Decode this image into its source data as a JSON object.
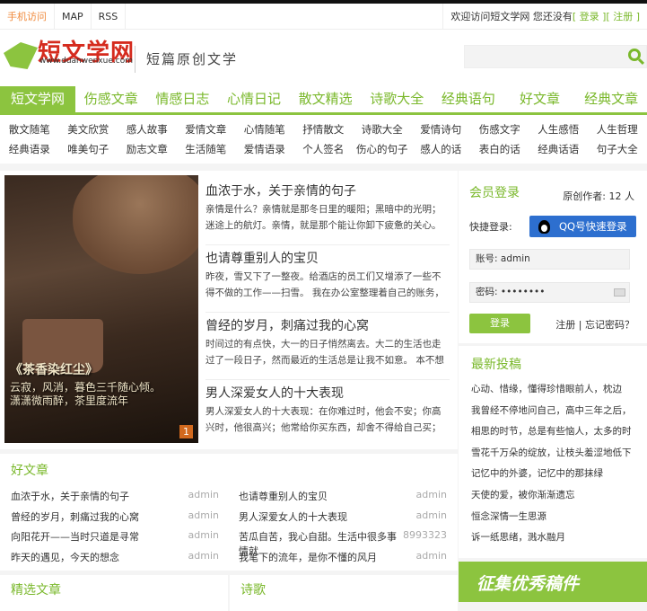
{
  "topbar": {
    "mobile": "手机访问",
    "map": "MAP",
    "rss": "RSS",
    "welcome": "欢迎访问短文学网 您还没有",
    "login": "[ 登录 ]",
    "register": "[ 注册 ]"
  },
  "header": {
    "logo": "短文学网",
    "url": "www.duanwenxue.com",
    "slogan": "短篇原创文学"
  },
  "nav": [
    "短文学网",
    "伤感文章",
    "情感日志",
    "心情日记",
    "散文精选",
    "诗歌大全",
    "经典语句",
    "好文章",
    "经典文章"
  ],
  "subnav": [
    [
      "散文随笔",
      "美文欣赏",
      "感人故事",
      "爱情文章",
      "心情随笔",
      "抒情散文",
      "诗歌大全",
      "爱情诗句",
      "伤感文字",
      "人生感悟",
      "人生哲理"
    ],
    [
      "经典语录",
      "唯美句子",
      "励志文章",
      "生活随笔",
      "爱情语录",
      "个人签名",
      "伤心的句子",
      "感人的话",
      "表白的话",
      "经典话语",
      "句子大全"
    ]
  ],
  "slide": {
    "title": "《茶香染红尘》",
    "line1": "云寂，风消，暮色三千随心倾。",
    "line2": "潇潇微雨醉，茶里度流年",
    "index": "1"
  },
  "articles": [
    {
      "title": "血浓于水，关于亲情的句子",
      "summary": "亲情是什么？亲情就是那冬日里的暖阳；黑暗中的光明；迷途上的航灯。亲情，就是那个能让你卸下疲惫的关心。"
    },
    {
      "title": "也请尊重别人的宝贝",
      "summary": "昨夜，雪又下了一整夜。给酒店的员工们又增添了一些不得不做的工作——扫雪。 我在办公室整理着自己的账务，"
    },
    {
      "title": "曾经的岁月，刺痛过我的心窝",
      "summary": "时间过的有点快，大一的日子悄然离去。大二的生活也走过了一段日子，然而最近的生活总是让我不如意。 本不想"
    },
    {
      "title": "男人深爱女人的十大表现",
      "summary": "男人深爱女人的十大表现：在你难过时，他会不安；你高兴时，他很高兴；他常给你买东西，却舍不得给自己买；"
    }
  ],
  "good": {
    "title": "好文章",
    "left": [
      {
        "t": "血浓于水，关于亲情的句子",
        "a": "admin"
      },
      {
        "t": "曾经的岁月，刺痛过我的心窝",
        "a": "admin"
      },
      {
        "t": "向阳花开——当时只道是寻常",
        "a": "admin"
      },
      {
        "t": "昨天的遇见，今天的想念",
        "a": "admin"
      }
    ],
    "right": [
      {
        "t": "也请尊重别人的宝贝",
        "a": "admin"
      },
      {
        "t": "男人深爱女人的十大表现",
        "a": "admin"
      },
      {
        "t": "苦瓜自苦，我心自甜。生活中很多事情就",
        "a": "8993323"
      },
      {
        "t": "我笔下的流年，是你不懂的风月",
        "a": "admin"
      }
    ]
  },
  "bottom": {
    "featured": "精选文章",
    "poetry": "诗歌"
  },
  "login": {
    "title": "会员登录",
    "authors": "原创作者: 12 人",
    "quick": "快捷登录:",
    "qq": "QQ号快速登录",
    "user_label": "账号:",
    "user": "admin",
    "pass_label": "密码:",
    "pass": "••••••••",
    "submit": "登录",
    "register": "注册",
    "forgot": "忘记密码？"
  },
  "newest": {
    "title": "最新投稿",
    "items": [
      "心动、惜缘，懂得珍惜眼前人，枕边",
      "我曾经不停地问自己，高中三年之后，",
      "相思的时节，总是有些恼人，太多的时",
      "雪花千万朵的绽放，让枝头羞涩地低下",
      "记忆中的外婆，记忆中的那抹绿",
      "天使的爱，被你渐渐遗忘",
      "恒念深情一生思源",
      "诉一纸思绪，溅水融月"
    ]
  },
  "banner": "征集优秀稿件"
}
